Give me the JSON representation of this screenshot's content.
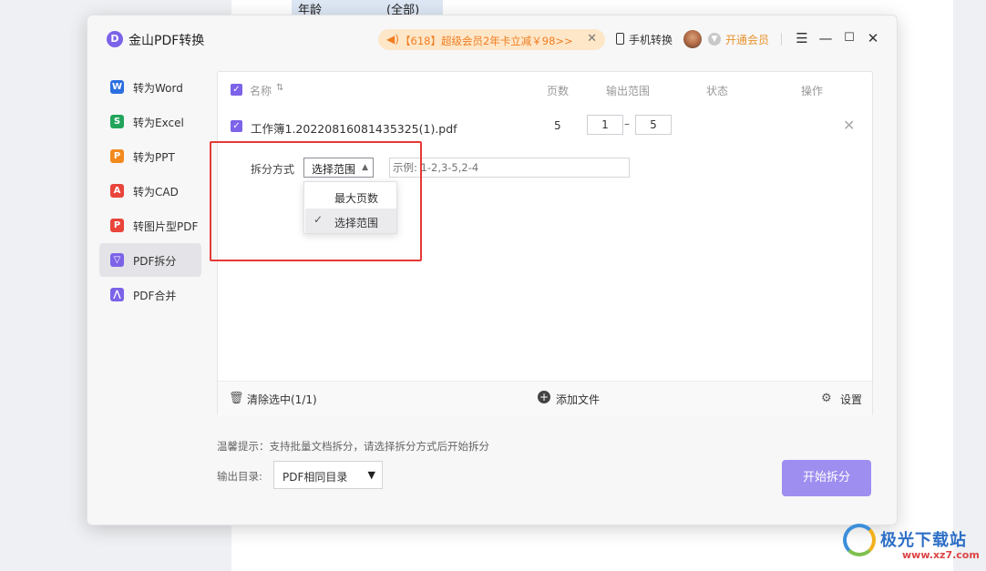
{
  "background": {
    "cells": [
      "年龄",
      "(全部)"
    ]
  },
  "titlebar": {
    "logo_letter": "D",
    "app_title": "金山PDF转换",
    "promo_icon": "speaker-icon",
    "promo_text": "【618】超级会员2年卡立减￥98>>",
    "mobile_label": "手机转换",
    "vip_label": "开通会员"
  },
  "sidebar": {
    "items": [
      {
        "label": "转为Word",
        "icon": "W",
        "color": "#2b6fe0"
      },
      {
        "label": "转为Excel",
        "icon": "S",
        "color": "#22a55a"
      },
      {
        "label": "转为PPT",
        "icon": "P",
        "color": "#f28a1e"
      },
      {
        "label": "转为CAD",
        "icon": "A",
        "color": "#e9453b"
      },
      {
        "label": "转图片型PDF",
        "icon": "P",
        "color": "#e9453b"
      },
      {
        "label": "PDF拆分",
        "icon": "▽",
        "color": "#7c63e8"
      },
      {
        "label": "PDF合并",
        "icon": "⋀",
        "color": "#7c63e8"
      }
    ],
    "active_index": 5
  },
  "table": {
    "headers": {
      "name": "名称",
      "pages": "页数",
      "range": "输出范围",
      "status": "状态",
      "action": "操作"
    },
    "row": {
      "file_name": "工作簿1.20220816081435325(1).pdf",
      "pages": "5",
      "range_from": "1",
      "range_to": "5"
    }
  },
  "split": {
    "label": "拆分方式",
    "selected": "选择范围",
    "placeholder": "示例: 1-2,3-5,2-4",
    "options": [
      "最大页数",
      "选择范围"
    ],
    "selected_index": 1
  },
  "panel_footer": {
    "clear_label": "清除选中(1/1)",
    "add_label": "添加文件",
    "settings_label": "设置"
  },
  "hint": "温馨提示：支持批量文档拆分，请选择拆分方式后开始拆分",
  "output": {
    "label": "输出目录:",
    "value": "PDF相同目录"
  },
  "start_button": "开始拆分",
  "watermark": {
    "text": "极光下载站",
    "url": "www.xz7.com"
  }
}
